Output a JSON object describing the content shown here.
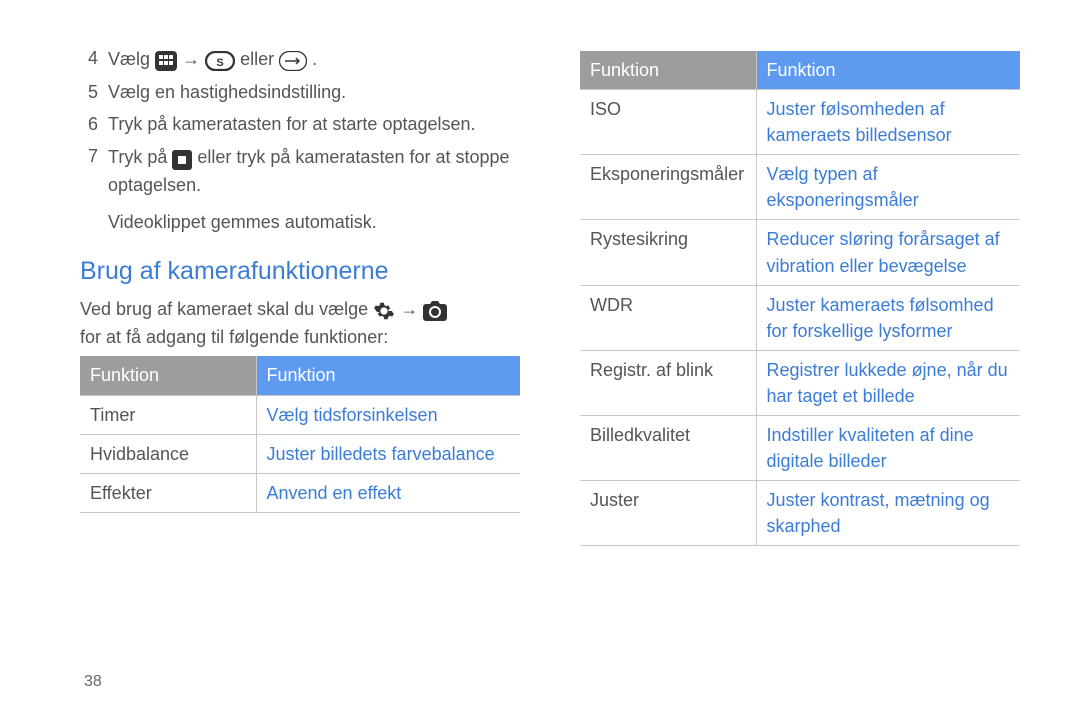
{
  "page_number": "38",
  "left": {
    "steps": [
      {
        "n": "4",
        "before": "Vælg ",
        "after_arrow": " eller ",
        "end": ".",
        "type": "icons"
      },
      {
        "n": "5",
        "text": "Vælg en hastighedsindstilling."
      },
      {
        "n": "6",
        "text": "Tryk på kameratasten for at starte optagelsen."
      },
      {
        "n": "7",
        "before": "Tryk på ",
        "after": " eller tryk på kameratasten for at stoppe optagelsen.",
        "type": "stop"
      }
    ],
    "note": "Videoklippet gemmes automatisk.",
    "heading": "Brug af kamerafunktionerne",
    "intro_before": "Ved brug af kameraet skal du vælge ",
    "intro_after": "for at få adgang til følgende funktioner:",
    "arrow": "→",
    "table": {
      "h1": "Funktion",
      "h2": "Funktion",
      "rows": [
        {
          "name": "Timer",
          "desc": "Vælg tidsforsinkelsen"
        },
        {
          "name": "Hvidbalance",
          "desc": "Juster billedets farvebalance"
        },
        {
          "name": "Effekter",
          "desc": "Anvend en effekt"
        }
      ]
    }
  },
  "right": {
    "table": {
      "h1": "Funktion",
      "h2": "Funktion",
      "rows": [
        {
          "name": "ISO",
          "desc": "Juster følsomheden af kameraets billedsensor"
        },
        {
          "name": "Eksponeringsmåler",
          "desc": "Vælg typen af eksponeringsmåler"
        },
        {
          "name": "Rystesikring",
          "desc": "Reducer sløring forårsaget af vibration eller bevægelse"
        },
        {
          "name": "WDR",
          "desc": "Juster kameraets følsomhed for forskellige lysformer"
        },
        {
          "name": "Registr. af blink",
          "desc": "Registrer lukkede øjne, når du har taget et billede"
        },
        {
          "name": "Billedkvalitet",
          "desc": "Indstiller kvaliteten af dine digitale billeder"
        },
        {
          "name": "Juster",
          "desc": "Juster kontrast, mætning og skarphed"
        }
      ]
    }
  }
}
